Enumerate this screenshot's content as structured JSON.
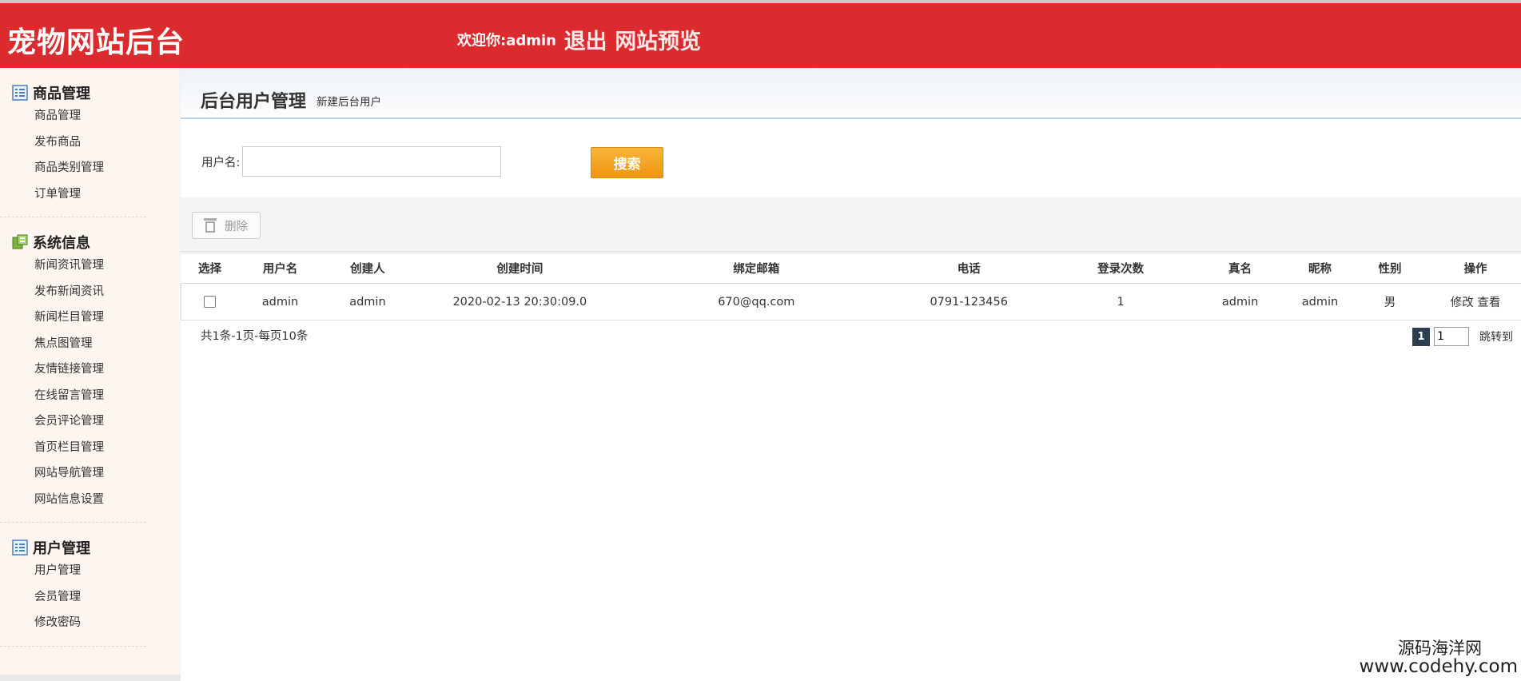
{
  "header": {
    "logo": "宠物网站后台",
    "welcome": "欢迎你:admin",
    "logout": "退出",
    "preview": "网站预览"
  },
  "sidebar": {
    "groups": [
      {
        "title": "商品管理",
        "icon": "list-icon",
        "items": [
          "商品管理",
          "发布商品",
          "商品类别管理",
          "订单管理"
        ]
      },
      {
        "title": "系统信息",
        "icon": "system-icon",
        "items": [
          "新闻资讯管理",
          "发布新闻资讯",
          "新闻栏目管理",
          "焦点图管理",
          "友情链接管理",
          "在线留言管理",
          "会员评论管理",
          "首页栏目管理",
          "网站导航管理",
          "网站信息设置"
        ]
      },
      {
        "title": "用户管理",
        "icon": "list-icon",
        "items": [
          "用户管理",
          "会员管理",
          "修改密码"
        ]
      }
    ]
  },
  "main": {
    "title": "后台用户管理",
    "subtitle": "新建后台用户",
    "search": {
      "label": "用户名:",
      "value": "",
      "button": "搜索"
    },
    "delete_button": "删除",
    "table": {
      "headers": [
        "选择",
        "用户名",
        "创建人",
        "创建时间",
        "绑定邮箱",
        "电话",
        "登录次数",
        "真名",
        "昵称",
        "性别",
        "操作"
      ],
      "rows": [
        {
          "username": "admin",
          "creator": "admin",
          "created": "2020-02-13 20:30:09.0",
          "email": "670@qq.com",
          "phone": "0791-123456",
          "logins": "1",
          "realname": "admin",
          "nickname": "admin",
          "gender": "男",
          "edit": "修改",
          "view": "查看"
        }
      ]
    },
    "pager": {
      "info": "共1条-1页-每页10条",
      "current": "1",
      "input": "1",
      "jump": "跳转到"
    }
  },
  "watermark": {
    "line1": "源码海洋网",
    "line2": "www.codehy.com"
  },
  "colors": {
    "header": "#db2b2e",
    "search_button": "#f5a623",
    "sidebar": "#fdf5f0"
  }
}
